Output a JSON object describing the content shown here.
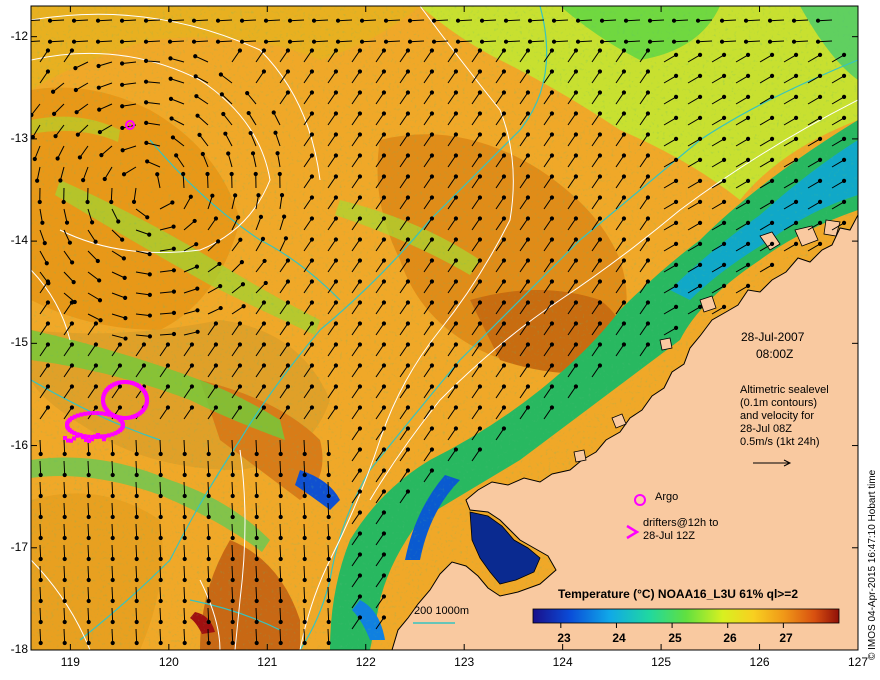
{
  "map": {
    "x_ticks": [
      "119",
      "120",
      "121",
      "122",
      "123",
      "124",
      "125",
      "126",
      "127"
    ],
    "y_ticks": [
      "-12",
      "-13",
      "-14",
      "-15",
      "-16",
      "-17",
      "-18"
    ],
    "lon_range": [
      118.6,
      127.0
    ],
    "lat_range": [
      -18.0,
      -11.7
    ],
    "grid": false
  },
  "annotations": {
    "date": "28-Jul-2007",
    "time": "08:00Z",
    "altimetry_lines": [
      "Altimetric sealevel",
      "(0.1m contours)",
      "and velocity for",
      "28-Jul 08Z",
      "0.5m/s (1kt 24h)"
    ],
    "argo_label": "Argo",
    "drifters_lines": [
      "drifters@12h to",
      "28-Jul 12Z"
    ],
    "bathy_label": "200  1000m"
  },
  "colorbar": {
    "title": "Temperature (°C) NOAA16_L3U 61% ql>=2",
    "ticks": [
      "23",
      "24",
      "25",
      "26",
      "27"
    ],
    "range": [
      22.5,
      28.0
    ]
  },
  "credit": "© IMOS 04-Apr-2015 16:47:10 Hobart time",
  "colors": {
    "land": "#f9c9a0",
    "warm": "#e8a020",
    "arrow": "#000000",
    "contour": "#ffffff",
    "bathy": "#36c4c0",
    "drifter": "#ff00ff"
  }
}
